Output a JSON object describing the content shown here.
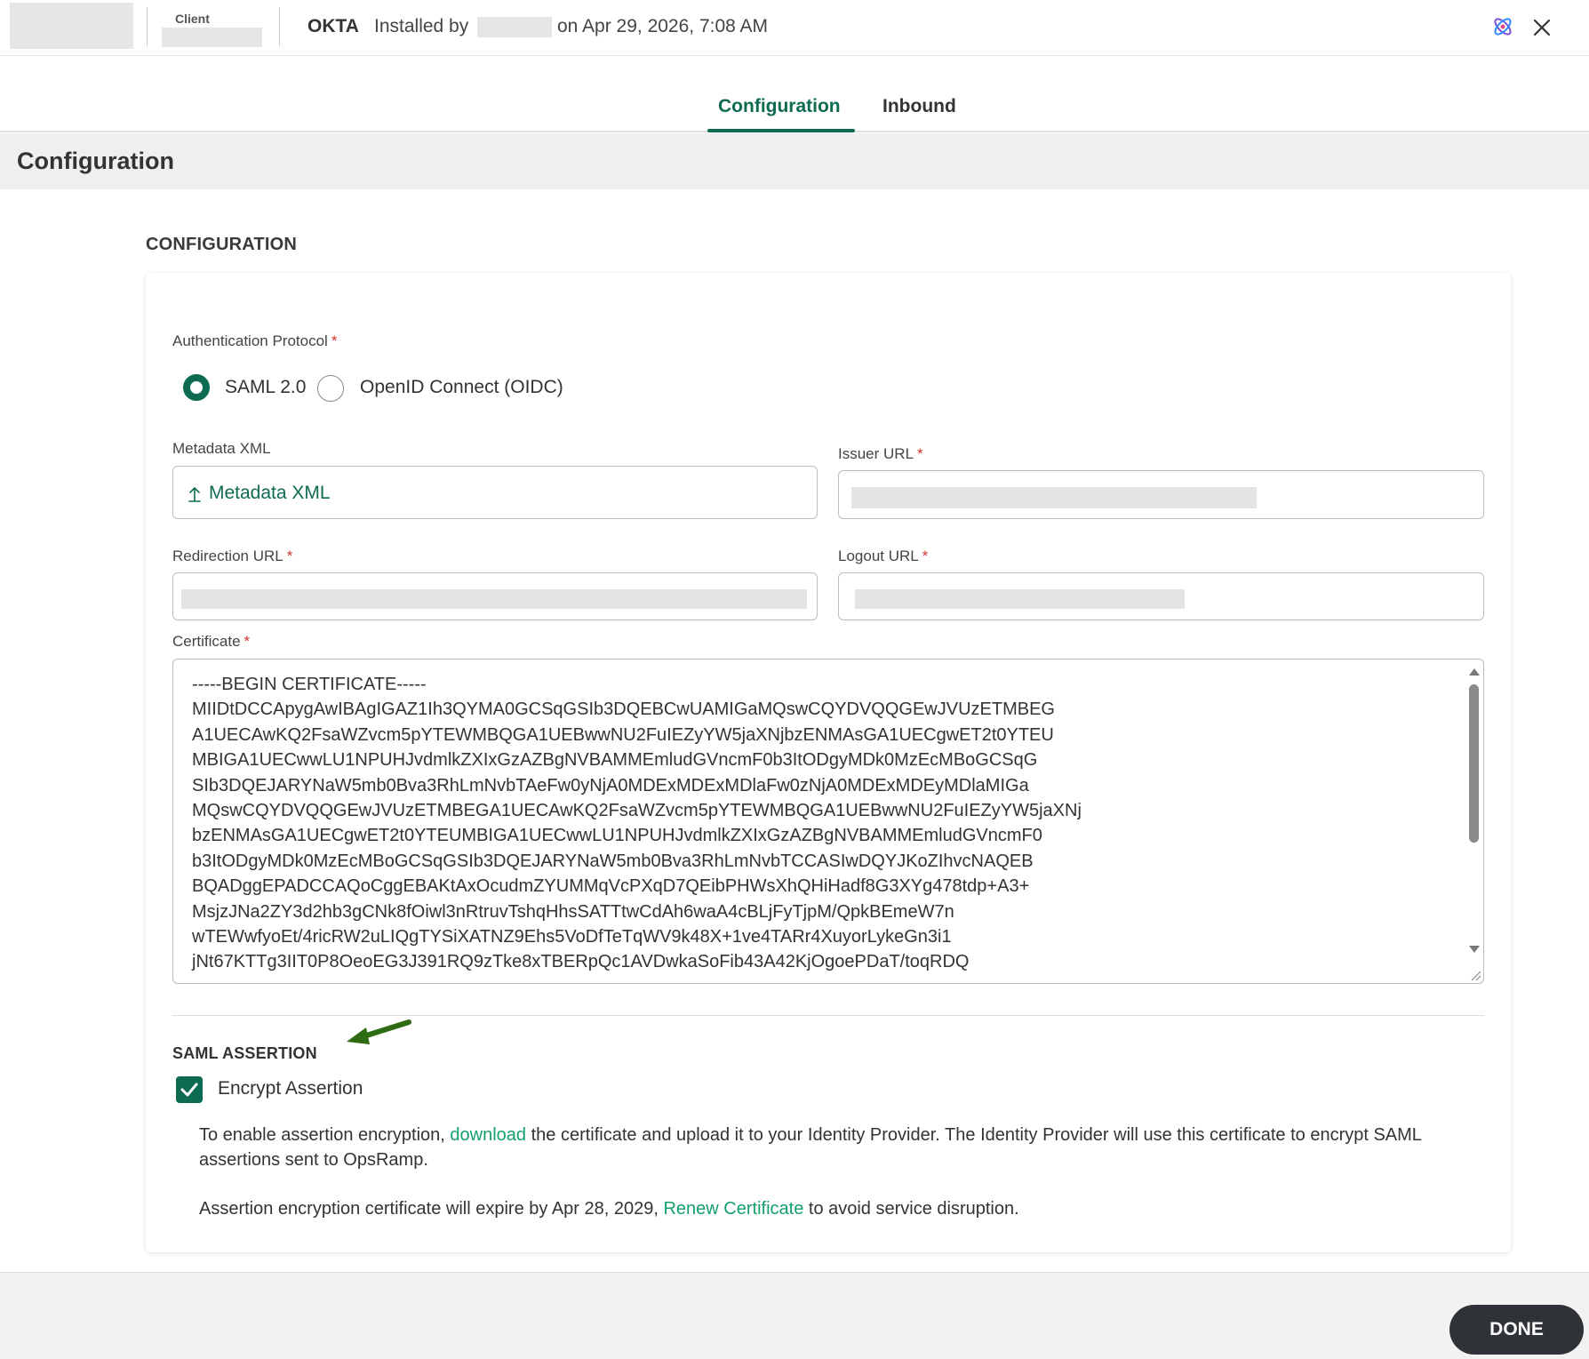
{
  "header": {
    "client_label": "Client",
    "app_name": "OKTA",
    "installed_by": "Installed by",
    "install_date": "on Apr 29, 2026, 7:08 AM",
    "icons": [
      "ai-assistant-icon",
      "close-icon"
    ]
  },
  "tabs": [
    {
      "label": "Configuration",
      "active": true
    },
    {
      "label": "Inbound",
      "active": false
    }
  ],
  "section_title": "Configuration",
  "config_heading": "CONFIGURATION",
  "form": {
    "auth_protocol_label": "Authentication Protocol",
    "required_mark": "*",
    "protocols": [
      {
        "label": "SAML 2.0",
        "selected": true
      },
      {
        "label": "OpenID Connect (OIDC)",
        "selected": false
      }
    ],
    "metadata_label": "Metadata XML",
    "metadata_button": "Metadata XML",
    "issuer_label": "Issuer URL",
    "redirection_label": "Redirection URL",
    "logout_label": "Logout URL",
    "certificate_label": "Certificate",
    "certificate_value": "-----BEGIN CERTIFICATE-----\nMIIDtDCCApygAwIBAgIGAZ1Ih3QYMA0GCSqGSIb3DQEBCwUAMIGaMQswCQYDVQQGEwJVUzETMBEG\nA1UECAwKQ2FsaWZvcm5pYTEWMBQGA1UEBwwNU2FuIEZyYW5jaXNjbzENMAsGA1UECgwET2t0YTEU\nMBIGA1UECwwLU1NPUHJvdmlkZXIxGzAZBgNVBAMMEmludGVncmF0b3ItODgyMDk0MzEcMBoGCSqG\nSIb3DQEJARYNaW5mb0Bva3RhLmNvbTAeFw0yNjA0MDExMDExMDlaFw0zNjA0MDExMDEyMDlaMIGa\nMQswCQYDVQQGEwJVUzETMBEGA1UECAwKQ2FsaWZvcm5pYTEWMBQGA1UEBwwNU2FuIEZyYW5jaXNj\nbzENMAsGA1UECgwET2t0YTEUMBIGA1UECwwLU1NPUHJvdmlkZXIxGzAZBgNVBAMMEmludGVncmF0\nb3ItODgyMDk0MzEcMBoGCSqGSIb3DQEJARYNaW5mb0Bva3RhLmNvbTCCASIwDQYJKoZIhvcNAQEB\nBQADggEPADCCAQoCggEBAKtAxOcudmZYUMMqVcPXqD7QEibPHWsXhQHiHadf8G3XYg478tdp+A3+\nMsjzJNa2ZY3d2hb3gCNk8fOiwl3nRtruvTshqHhsSATTtwCdAh6waA4cBLjFyTjpM/QpkBEmeW7n\nwTEWwfyoEt/4ricRW2uLIQgTYSiXATNZ9Ehs5VoDfTeTqWV9k48X+1ve4TARr4XuyorLykeGn3i1\njNt67KTTg3IIT0P8OeoEG3J391RQ9zTke8xTBERpQc1AVDwkaSoFib43A42KjOgoePDaT/toqRDQ"
  },
  "saml": {
    "heading": "SAML ASSERTION",
    "encrypt_label": "Encrypt Assertion",
    "encrypt_checked": true,
    "para1_before": "To enable assertion encryption, ",
    "para1_link": "download",
    "para1_after": " the certificate and upload it to your Identity Provider. The Identity Provider will use this certificate to encrypt SAML assertions sent to OpsRamp.",
    "para2_before": "Assertion encryption certificate will expire by Apr 28, 2029, ",
    "para2_link": "Renew Certificate",
    "para2_after": " to avoid service disruption."
  },
  "footer": {
    "done_label": "DONE"
  },
  "colors": {
    "brand_green": "#0d6b52",
    "link_green": "#13a06a",
    "required_red": "#d0342c",
    "done_bg": "#2f3237"
  }
}
